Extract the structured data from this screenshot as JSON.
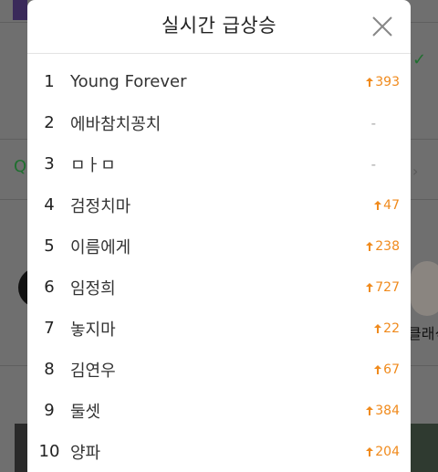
{
  "modal": {
    "title": "실시간 급상승",
    "close_icon": "close-icon"
  },
  "ranking": [
    {
      "rank": "1",
      "keyword": "Young Forever",
      "change": "393",
      "direction": "up"
    },
    {
      "rank": "2",
      "keyword": "에바참치꽁치",
      "change": "-",
      "direction": "none"
    },
    {
      "rank": "3",
      "keyword": "ㅁㅏㅁ",
      "change": "-",
      "direction": "none"
    },
    {
      "rank": "4",
      "keyword": "검정치마",
      "change": "47",
      "direction": "up"
    },
    {
      "rank": "5",
      "keyword": "이름에게",
      "change": "238",
      "direction": "up"
    },
    {
      "rank": "6",
      "keyword": "임정희",
      "change": "727",
      "direction": "up"
    },
    {
      "rank": "7",
      "keyword": "놓지마",
      "change": "22",
      "direction": "up"
    },
    {
      "rank": "8",
      "keyword": "김연우",
      "change": "67",
      "direction": "up"
    },
    {
      "rank": "9",
      "keyword": "둘셋",
      "change": "384",
      "direction": "up"
    },
    {
      "rank": "10",
      "keyword": "양파",
      "change": "204",
      "direction": "up"
    }
  ],
  "background": {
    "right_text": "클래식"
  },
  "colors": {
    "accent_up": "#f08a1c",
    "no_change": "#aaaaaa",
    "overlay": "#6f6f6f"
  }
}
